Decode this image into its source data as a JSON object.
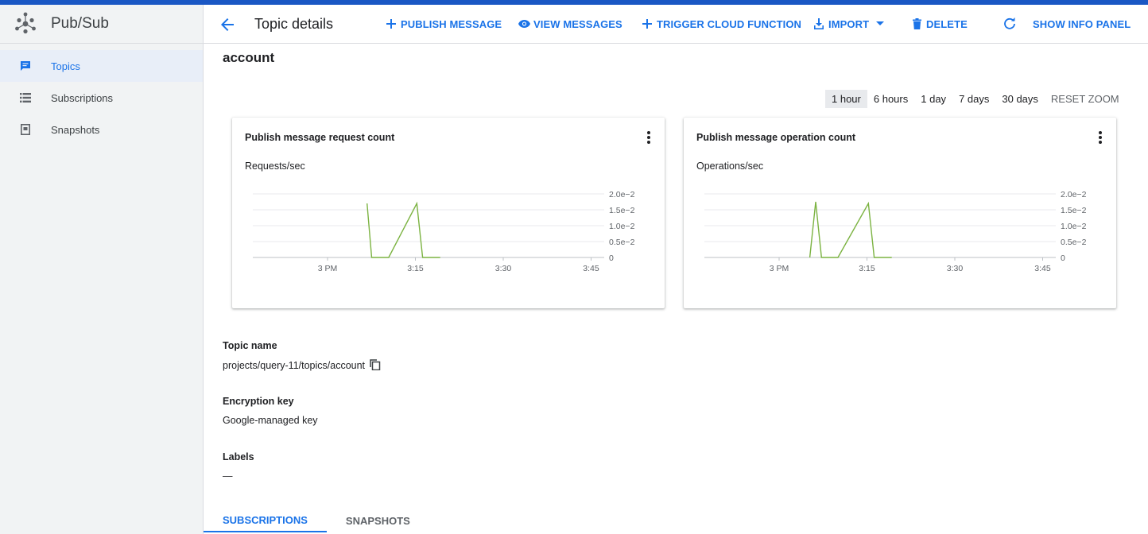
{
  "app": {
    "name": "Pub/Sub",
    "logo_icon": "pubsub-logo-icon"
  },
  "sidebar": {
    "items": [
      {
        "label": "Topics",
        "icon": "message-icon",
        "active": true
      },
      {
        "label": "Subscriptions",
        "icon": "list-icon",
        "active": false
      },
      {
        "label": "Snapshots",
        "icon": "snapshot-icon",
        "active": false
      }
    ]
  },
  "header": {
    "title": "Topic details",
    "actions": {
      "publish": "PUBLISH MESSAGE",
      "view": "VIEW MESSAGES",
      "trigger": "TRIGGER CLOUD FUNCTION",
      "import": "IMPORT",
      "delete": "DELETE",
      "info": "SHOW INFO PANEL"
    }
  },
  "topic": {
    "name": "account"
  },
  "time_range": {
    "options": [
      "1 hour",
      "6 hours",
      "1 day",
      "7 days",
      "30 days"
    ],
    "selected": "1 hour",
    "reset": "RESET ZOOM"
  },
  "chart_data": [
    {
      "type": "line",
      "title": "Publish message request count",
      "ylabel": "Requests/sec",
      "x_ticks": [
        "3 PM",
        "3:15",
        "3:30",
        "3:45"
      ],
      "y_ticks": [
        "2.0e−2",
        "1.5e−2",
        "1.0e−2",
        "0.5e−2",
        "0"
      ],
      "ylim": [
        0,
        0.02
      ],
      "xlim_minutes": [
        0,
        60
      ],
      "series": [
        {
          "color": "#7cb342",
          "points": [
            [
              19.5,
              0.017
            ],
            [
              20.3,
              0
            ],
            [
              23.2,
              0
            ],
            [
              28.0,
              0.017
            ],
            [
              29.0,
              0
            ],
            [
              32.0,
              0
            ]
          ]
        }
      ]
    },
    {
      "type": "line",
      "title": "Publish message operation count",
      "ylabel": "Operations/sec",
      "x_ticks": [
        "3 PM",
        "3:15",
        "3:30",
        "3:45"
      ],
      "y_ticks": [
        "2.0e−2",
        "1.5e−2",
        "1.0e−2",
        "0.5e−2",
        "0"
      ],
      "ylim": [
        0,
        0.02
      ],
      "xlim_minutes": [
        0,
        60
      ],
      "series": [
        {
          "color": "#7cb342",
          "points": [
            [
              18.0,
              0
            ],
            [
              19.0,
              0.0175
            ],
            [
              20.0,
              0
            ],
            [
              22.8,
              0
            ],
            [
              28.0,
              0.017
            ],
            [
              29.0,
              0
            ],
            [
              32.0,
              0
            ]
          ]
        }
      ]
    }
  ],
  "details": {
    "topic_name_label": "Topic name",
    "topic_name_value": "projects/query-11/topics/account",
    "encryption_label": "Encryption key",
    "encryption_value": "Google-managed key",
    "labels_label": "Labels",
    "labels_value": "—"
  },
  "tabs": {
    "subscriptions": "SUBSCRIPTIONS",
    "snapshots": "SNAPSHOTS"
  }
}
